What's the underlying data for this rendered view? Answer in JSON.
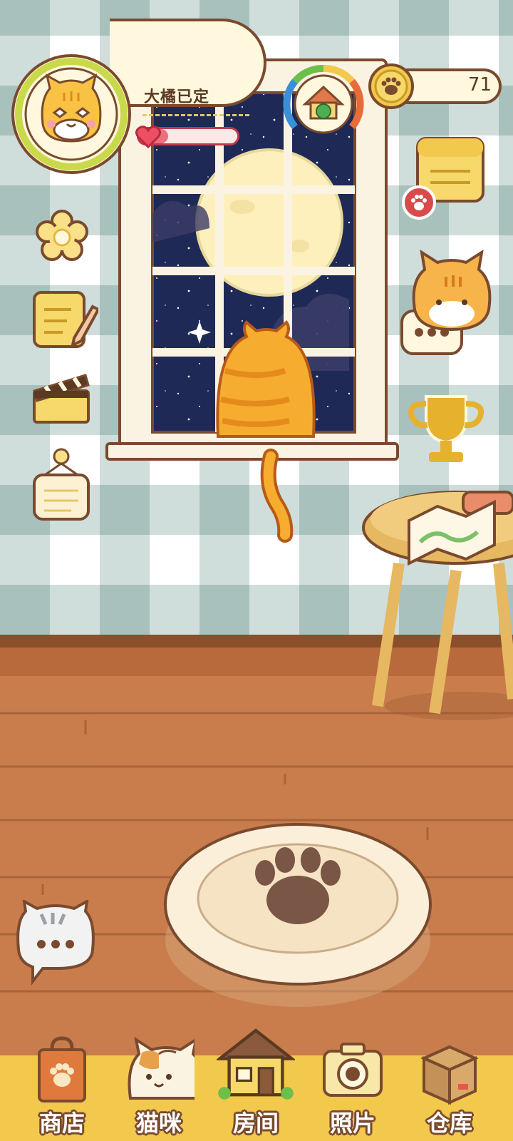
{
  "cat": {
    "name": "大橘已定",
    "affection_level": 0.3
  },
  "currency": {
    "coins": "71",
    "coin_icon": "paw-coin-icon"
  },
  "mood_gauge": {
    "icon": "cat-house-icon",
    "level": 0.75
  },
  "left_menu": [
    {
      "name": "flower-icon"
    },
    {
      "name": "notepad-pencil-icon"
    },
    {
      "name": "clapperboard-icon"
    },
    {
      "name": "hanging-sign-icon"
    }
  ],
  "right_menu": [
    {
      "name": "notebook-icon",
      "badge": "paw-badge-icon"
    },
    {
      "name": "orange-cat-chat-icon"
    },
    {
      "name": "trophy-icon"
    }
  ],
  "chat_bubble": {
    "icon": "gray-cat-chat-icon"
  },
  "nav": {
    "shop": "商店",
    "cats": "猫咪",
    "room": "房间",
    "photos": "照片",
    "storage": "仓库"
  },
  "colors": {
    "wall_light": "#ffffff",
    "wall_check": "#c7d8d4",
    "floor": "#c97d4c",
    "nav_bar": "#f2c94c",
    "outline": "#7a4a2e",
    "night_sky": "#1e2a55"
  }
}
